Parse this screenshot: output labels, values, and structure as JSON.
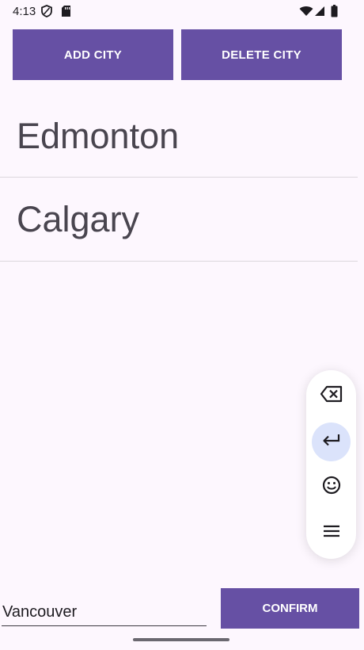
{
  "status_bar": {
    "time": "4:13",
    "icons": [
      "shield-icon",
      "sd-card-icon",
      "wifi-icon",
      "cellular-signal-icon",
      "battery-icon"
    ]
  },
  "toolbar": {
    "add_city_label": "ADD CITY",
    "delete_city_label": "DELETE CITY"
  },
  "city_list": {
    "items": [
      {
        "name": "Edmonton"
      },
      {
        "name": "Calgary"
      }
    ]
  },
  "keyboard_toolbar": {
    "buttons": [
      "backspace-icon",
      "enter-icon",
      "emoji-icon",
      "menu-icon"
    ]
  },
  "input": {
    "value": "Vancouver",
    "placeholder": ""
  },
  "confirm_label": "CONFIRM",
  "colors": {
    "primary": "#6650a4",
    "background": "#fdf7fe",
    "on_primary": "#ffffff",
    "list_text": "#49454f",
    "divider": "#dcd7dd",
    "active_key": "#dbe3fb"
  }
}
